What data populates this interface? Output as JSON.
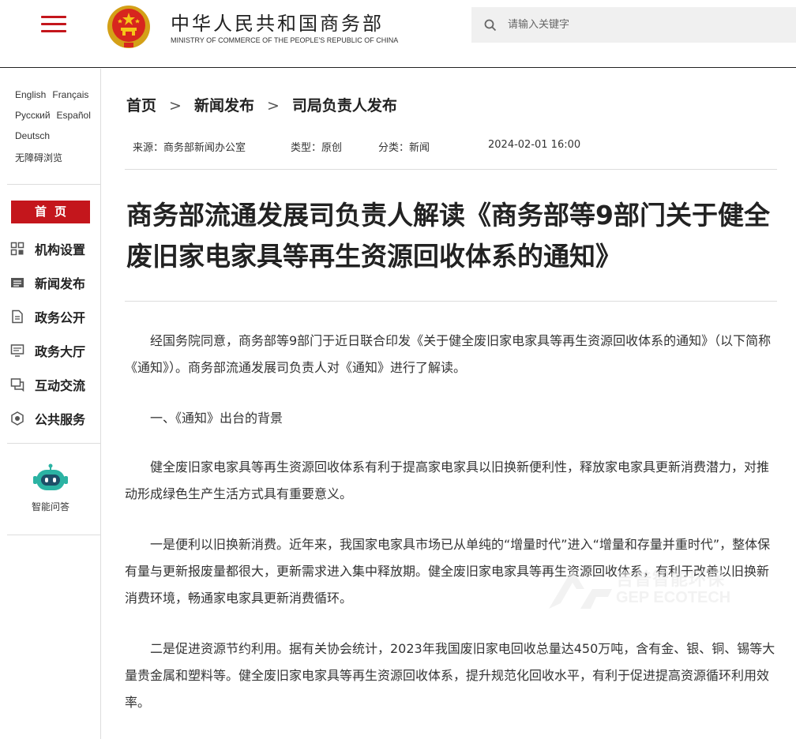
{
  "header": {
    "menu_icon": "hamburger-icon",
    "site_title": "中华人民共和国商务部",
    "site_subtitle": "MINISTRY OF COMMERCE OF THE PEOPLE'S REPUBLIC OF CHINA",
    "search_placeholder": "请输入关键字",
    "brand_color": "#c4161c"
  },
  "sidebar": {
    "languages": [
      [
        "English",
        "Français"
      ],
      [
        "Русский",
        "Español"
      ],
      [
        "Deutsch"
      ],
      [
        "无障碍浏览"
      ]
    ],
    "home_label": "首页",
    "nav_items": [
      {
        "label": "机构设置",
        "icon": "org-grid-icon"
      },
      {
        "label": "新闻发布",
        "icon": "news-list-icon"
      },
      {
        "label": "政务公开",
        "icon": "document-icon"
      },
      {
        "label": "政务大厅",
        "icon": "monitor-icon"
      },
      {
        "label": "互动交流",
        "icon": "chat-icon"
      },
      {
        "label": "公共服务",
        "icon": "service-icon"
      }
    ],
    "bot_label": "智能问答"
  },
  "breadcrumb": [
    "首页",
    "新闻发布",
    "司局负责人发布"
  ],
  "meta": {
    "source": "来源：商务部新闻办公室",
    "type": "类型：原创",
    "category": "分类：新闻",
    "date": "2024-02-01 16:00"
  },
  "article": {
    "title": "商务部流通发展司负责人解读《商务部等9部门关于健全废旧家电家具等再生资源回收体系的通知》",
    "paragraphs": [
      "经国务院同意，商务部等9部门于近日联合印发《关于健全废旧家电家具等再生资源回收体系的通知》（以下简称《通知》）。商务部流通发展司负责人对《通知》进行了解读。",
      "一、《通知》出台的背景",
      "健全废旧家电家具等再生资源回收体系有利于提高家电家具以旧换新便利性，释放家电家具更新消费潜力，对推动形成绿色生产生活方式具有重要意义。",
      "一是便利以旧换新消费。近年来，我国家电家具市场已从单纯的“增量时代”进入“增量和存量并重时代”，整体保有量与更新报废量都很大，更新需求进入集中释放期。健全废旧家电家具等再生资源回收体系，有利于改善以旧换新消费环境，畅通家电家具更新消费循环。",
      "二是促进资源节约利用。据有关协会统计，2023年我国废旧家电回收总量达450万吨，含有金、银、铜、锡等大量贵金属和塑料等。健全废旧家电家具等再生资源回收体系，提升规范化回收水平，有利于促进提高资源循环利用效率。"
    ]
  },
  "watermark": {
    "cn": "吉普智能环保",
    "en": "GEP ECOTECH"
  }
}
